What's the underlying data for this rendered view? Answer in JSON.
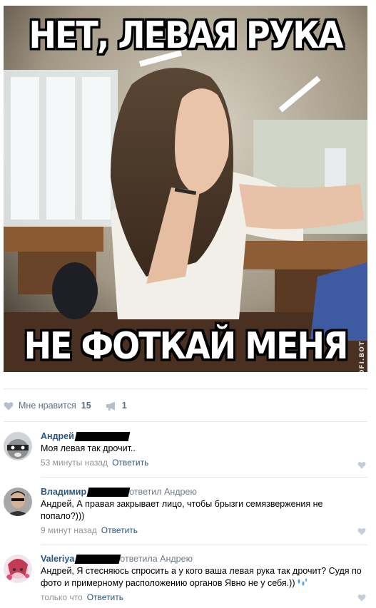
{
  "meme": {
    "caption_top": "НЕТ, ЛЕВАЯ РУКА",
    "caption_bottom": "НЕ ФОТКАЙ МЕНЯ",
    "watermark": "KOFI.BOT"
  },
  "post_actions": {
    "like_label": "Мне нравится",
    "like_count": "15",
    "share_count": "1"
  },
  "comments": [
    {
      "author": "Андрей",
      "reply_to": "",
      "text": "Моя левая так дрочит..",
      "time": "53 минуты назад",
      "reply_label": "Ответить"
    },
    {
      "author": "Владимир",
      "reply_to": "ответил Андрею",
      "text": "Андрей, А правая закрывает лицо, чтобы брызги семязвержения не попало?)))",
      "time": "9 минут назад",
      "reply_label": "Ответить"
    },
    {
      "author": "Valeriya",
      "reply_to": "ответила Андрею",
      "text": "Андрей, Я стесняюсь спросить а у кого ваша левая рука так дрочит? Судя по фото и примерному расположению органов Явно не у себя.))",
      "time": "только что",
      "reply_label": "Ответить"
    }
  ],
  "colors": {
    "link": "#2a5885",
    "meta": "#939393",
    "icon": "#b5c0cc",
    "divider": "#e4e6ea"
  }
}
